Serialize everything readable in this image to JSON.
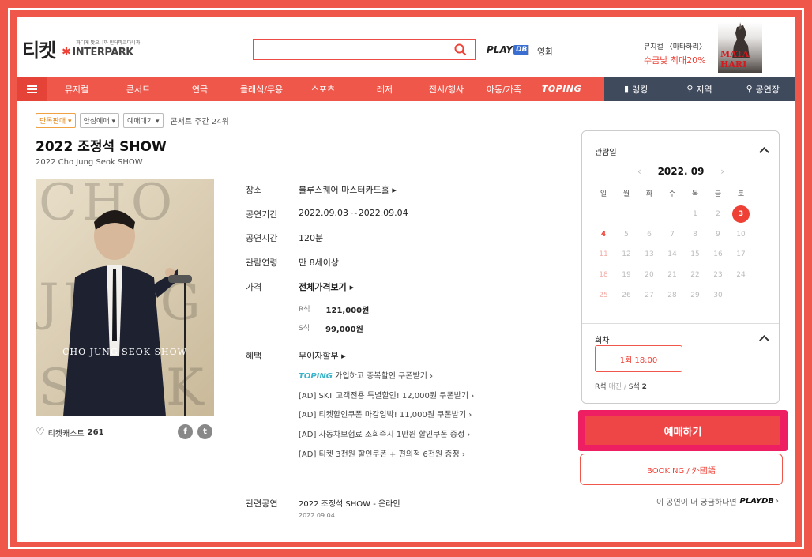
{
  "header": {
    "brand_ticket": "티켓",
    "brand_tag": "짜디게 맞으니까 인터파크다니까",
    "brand_name": "INTERPARK",
    "search_placeholder": "",
    "playdb_play": "PLAY",
    "playdb_db": "DB",
    "movie": "영화",
    "promo_line1": "뮤지컬 〈마타하리〉",
    "promo_line2": "수금낮 최대20%",
    "promo_image_title": "MATA HARI"
  },
  "nav": {
    "items": [
      "뮤지컬",
      "콘서트",
      "연극",
      "클래식/무용",
      "스포츠",
      "레저",
      "전시/행사",
      "아동/가족",
      "TOPING"
    ],
    "right_items": [
      "랭킹",
      "지역",
      "공연장"
    ]
  },
  "tags": {
    "exclusive": "단독판매 ▾",
    "safe": "안심예매 ▾",
    "waiting": "예매대기 ▾",
    "rank": "콘서트 주간 24위"
  },
  "show": {
    "title": "2022 조정석 SHOW",
    "title_en": "2022 Cho Jung Seok SHOW",
    "poster_caption": "CHO JUNG SEOK SHOW",
    "poster_big1": "CHO",
    "poster_big2": "JUNG",
    "poster_big3": "SEOK",
    "fan_label": "티켓캐스트",
    "fan_count": "261"
  },
  "info": {
    "venue_label": "장소",
    "venue": "블루스퀘어 마스터카드홀",
    "period_label": "공연기간",
    "period": "2022.09.03 ~2022.09.04",
    "runtime_label": "공연시간",
    "runtime": "120분",
    "age_label": "관람연령",
    "age": "만 8세이상",
    "price_label": "가격",
    "price_all": "전체가격보기",
    "prices": [
      {
        "grade": "R석",
        "price": "121,000원"
      },
      {
        "grade": "S석",
        "price": "99,000원"
      }
    ],
    "benefit_label": "혜택",
    "benefits": [
      "무이자할부",
      "가입하고 중복할인 쿠폰받기",
      "[AD] SKT 고객전용 특별할인! 12,000원 쿠폰받기",
      "[AD] 티켓할인쿠폰 마감임박! 11,000원 쿠폰받기",
      "[AD] 자동차보험료 조회즉시 1만원 할인쿠폰 증정",
      "[AD] 티켓 3천원 할인쿠폰 + 편의점 6천원 증정"
    ],
    "benefit_toping": "TOPING",
    "related_label": "관련공연",
    "related_title": "2022 조정석 SHOW - 온라인",
    "related_date": "2022.09.04"
  },
  "calendar": {
    "header": "관람일",
    "month": "2022. 09",
    "weekdays": [
      "일",
      "월",
      "화",
      "수",
      "목",
      "금",
      "토"
    ],
    "weeks": [
      [
        "",
        "",
        "",
        "",
        "1",
        "2",
        "3"
      ],
      [
        "4",
        "5",
        "6",
        "7",
        "8",
        "9",
        "10"
      ],
      [
        "11",
        "12",
        "13",
        "14",
        "15",
        "16",
        "17"
      ],
      [
        "18",
        "19",
        "20",
        "21",
        "22",
        "23",
        "24"
      ],
      [
        "25",
        "26",
        "27",
        "28",
        "29",
        "30",
        ""
      ]
    ],
    "selected": "3",
    "available": [
      "3",
      "4"
    ],
    "round_header": "회차",
    "round": "1회 18:00",
    "seat_r": "R석",
    "seat_r_status": "매진",
    "seat_sep": "/",
    "seat_s": "S석",
    "seat_s_count": "2"
  },
  "actions": {
    "book": "예매하기",
    "foreign": "BOOKING / 外國語",
    "more": "이 공연이 더 궁금하다면",
    "more_brand": "PLAYDB"
  },
  "colors": {
    "brand": "#ee574a",
    "accent": "#ee4035",
    "book_border": "#ee1e62",
    "nav_dark": "#3f4a5c"
  }
}
